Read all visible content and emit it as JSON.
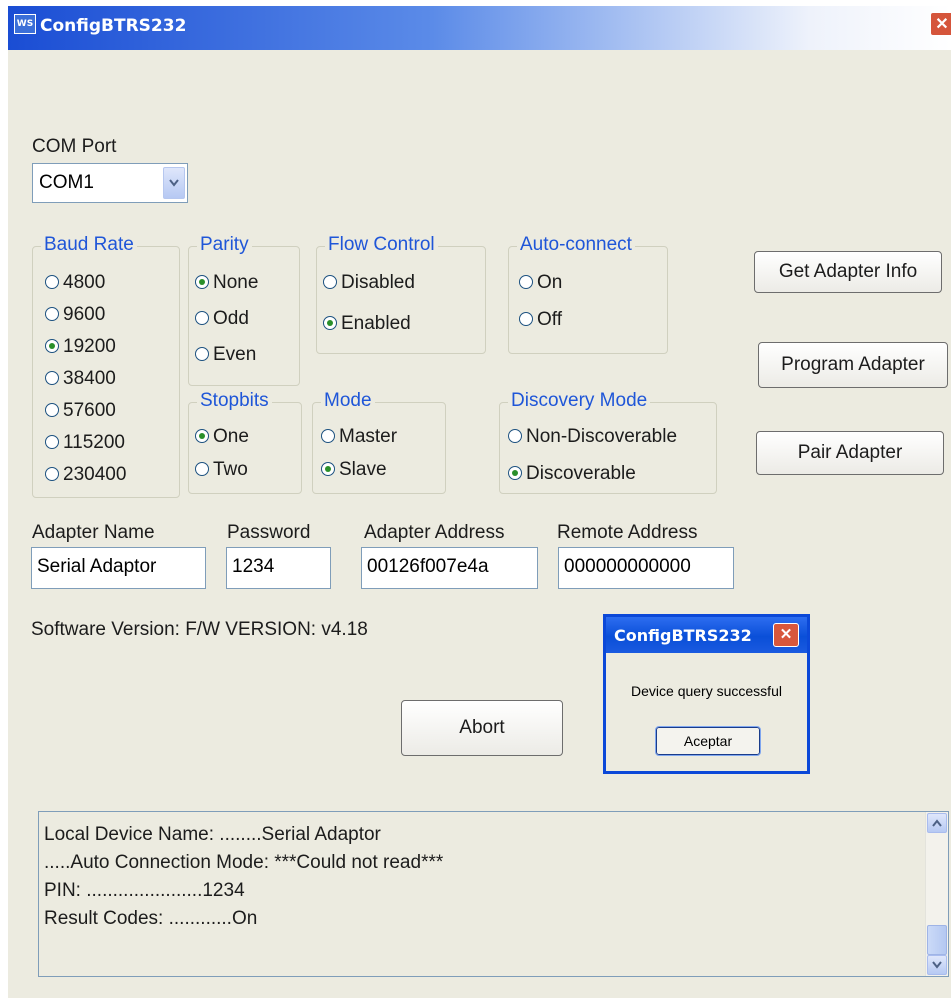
{
  "window": {
    "title": "ConfigBTRS232",
    "icon": "app-icon",
    "close_glyph": "✕"
  },
  "com_port": {
    "label": "COM Port",
    "value": "COM1"
  },
  "baud_rate": {
    "title": "Baud Rate",
    "options": [
      "4800",
      "9600",
      "19200",
      "38400",
      "57600",
      "115200",
      "230400"
    ],
    "selected": "19200"
  },
  "parity": {
    "title": "Parity",
    "options": [
      "None",
      "Odd",
      "Even"
    ],
    "selected": "None"
  },
  "flow_control": {
    "title": "Flow Control",
    "options": [
      "Disabled",
      "Enabled"
    ],
    "selected": "Enabled"
  },
  "auto_connect": {
    "title": "Auto-connect",
    "options": [
      "On",
      "Off"
    ],
    "selected": null
  },
  "stopbits": {
    "title": "Stopbits",
    "options": [
      "One",
      "Two"
    ],
    "selected": "One"
  },
  "mode": {
    "title": "Mode",
    "options": [
      "Master",
      "Slave"
    ],
    "selected": "Slave"
  },
  "discovery_mode": {
    "title": "Discovery Mode",
    "options": [
      "Non-Discoverable",
      "Discoverable"
    ],
    "selected": "Discoverable"
  },
  "buttons": {
    "get_info": "Get Adapter Info",
    "program": "Program Adapter",
    "pair": "Pair Adapter",
    "abort": "Abort"
  },
  "fields": {
    "adapter_name": {
      "label": "Adapter Name",
      "value": "Serial Adaptor"
    },
    "password": {
      "label": "Password",
      "value": "1234"
    },
    "adapter_address": {
      "label": "Adapter Address",
      "value": "00126f007e4a"
    },
    "remote_address": {
      "label": "Remote Address",
      "value": "000000000000"
    }
  },
  "software_version": "Software Version: F/W VERSION: v4.18",
  "dialog": {
    "title": "ConfigBTRS232",
    "message": "Device query successful",
    "ok": "Aceptar",
    "close_glyph": "✕"
  },
  "log": {
    "lines": [
      "Local Device Name: ........Serial Adaptor",
      ".....Auto Connection Mode: ***Could not read***",
      "PIN: ......................1234",
      "Result Codes: ............On"
    ]
  },
  "colors": {
    "accent": "#1f56d8",
    "window_bg": "#ecebe0",
    "radio_dot": "#2a8f2a"
  }
}
